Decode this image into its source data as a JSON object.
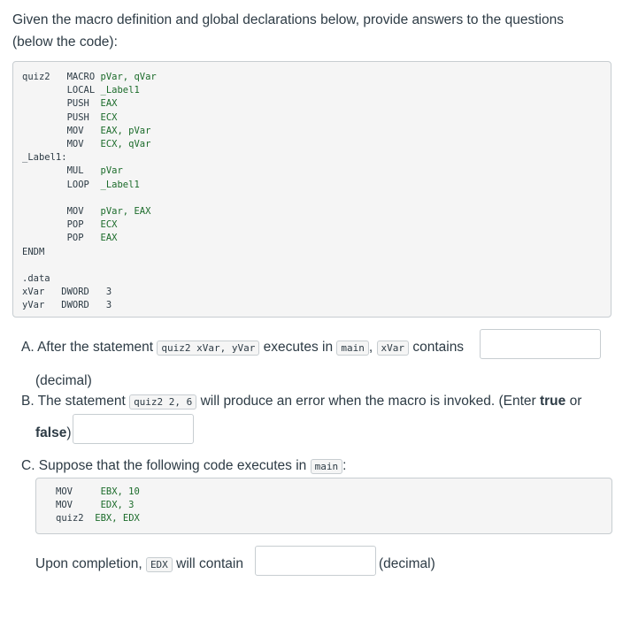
{
  "intro_text": "Given the macro definition and global declarations below, provide answers to the questions (below the code):",
  "macro_lines": [
    [
      {
        "t": "quiz2   ",
        "c": "lbl"
      },
      {
        "t": "MACRO ",
        "c": "kw"
      },
      {
        "t": "pVar, qVar",
        "c": "op"
      }
    ],
    [
      {
        "t": "        LOCAL ",
        "c": "kw"
      },
      {
        "t": "_Label1",
        "c": "op"
      }
    ],
    [
      {
        "t": "        PUSH  ",
        "c": "kw"
      },
      {
        "t": "EAX",
        "c": "op"
      }
    ],
    [
      {
        "t": "        PUSH  ",
        "c": "kw"
      },
      {
        "t": "ECX",
        "c": "op"
      }
    ],
    [
      {
        "t": "        MOV   ",
        "c": "kw"
      },
      {
        "t": "EAX, pVar",
        "c": "op"
      }
    ],
    [
      {
        "t": "        MOV   ",
        "c": "kw"
      },
      {
        "t": "ECX, qVar",
        "c": "op"
      }
    ],
    [
      {
        "t": "_Label1:",
        "c": "lbl"
      }
    ],
    [
      {
        "t": "        MUL   ",
        "c": "kw"
      },
      {
        "t": "pVar",
        "c": "op"
      }
    ],
    [
      {
        "t": "        LOOP  ",
        "c": "kw"
      },
      {
        "t": "_Label1",
        "c": "op"
      }
    ],
    [
      {
        "t": "",
        "c": "kw"
      }
    ],
    [
      {
        "t": "        MOV   ",
        "c": "kw"
      },
      {
        "t": "pVar, EAX",
        "c": "op"
      }
    ],
    [
      {
        "t": "        POP   ",
        "c": "kw"
      },
      {
        "t": "ECX",
        "c": "op"
      }
    ],
    [
      {
        "t": "        POP   ",
        "c": "kw"
      },
      {
        "t": "EAX",
        "c": "op"
      }
    ],
    [
      {
        "t": "ENDM",
        "c": "kw"
      }
    ],
    [
      {
        "t": "",
        "c": "kw"
      }
    ],
    [
      {
        "t": ".data",
        "c": "kw"
      }
    ],
    [
      {
        "t": "xVar   ",
        "c": "lbl"
      },
      {
        "t": "DWORD   ",
        "c": "kw"
      },
      {
        "t": "3",
        "c": "num"
      }
    ],
    [
      {
        "t": "yVar   ",
        "c": "lbl"
      },
      {
        "t": "DWORD   ",
        "c": "kw"
      },
      {
        "t": "3",
        "c": "num"
      }
    ]
  ],
  "qa": {
    "prefix": "A. After the statement",
    "code1": "quiz2 xVar, yVar",
    "mid": "executes in",
    "code2": "main",
    "comma": ",",
    "code3": "xVar",
    "suffix": "contains",
    "unit": "(decimal)"
  },
  "qb": {
    "prefix": "B. The statement",
    "code": "quiz2 2, 6",
    "suffix": "will produce an error when the macro is invoked. (Enter",
    "bold_true": "true",
    "or": "or",
    "bold_false": "false",
    "close": ")"
  },
  "qc": {
    "prefix": "C. Suppose that the following code executes in",
    "code": "main",
    "colon": ":",
    "lines": [
      [
        {
          "t": "MOV     ",
          "c": "kw"
        },
        {
          "t": "EBX, 10",
          "c": "op"
        }
      ],
      [
        {
          "t": "MOV     ",
          "c": "kw"
        },
        {
          "t": "EDX, 3",
          "c": "op"
        }
      ],
      [
        {
          "t": "quiz2  ",
          "c": "lbl"
        },
        {
          "t": "EBX, EDX",
          "c": "op"
        }
      ]
    ],
    "upon": "Upon completion,",
    "code_edx": "EDX",
    "will": "will contain",
    "unit": "(decimal)"
  }
}
